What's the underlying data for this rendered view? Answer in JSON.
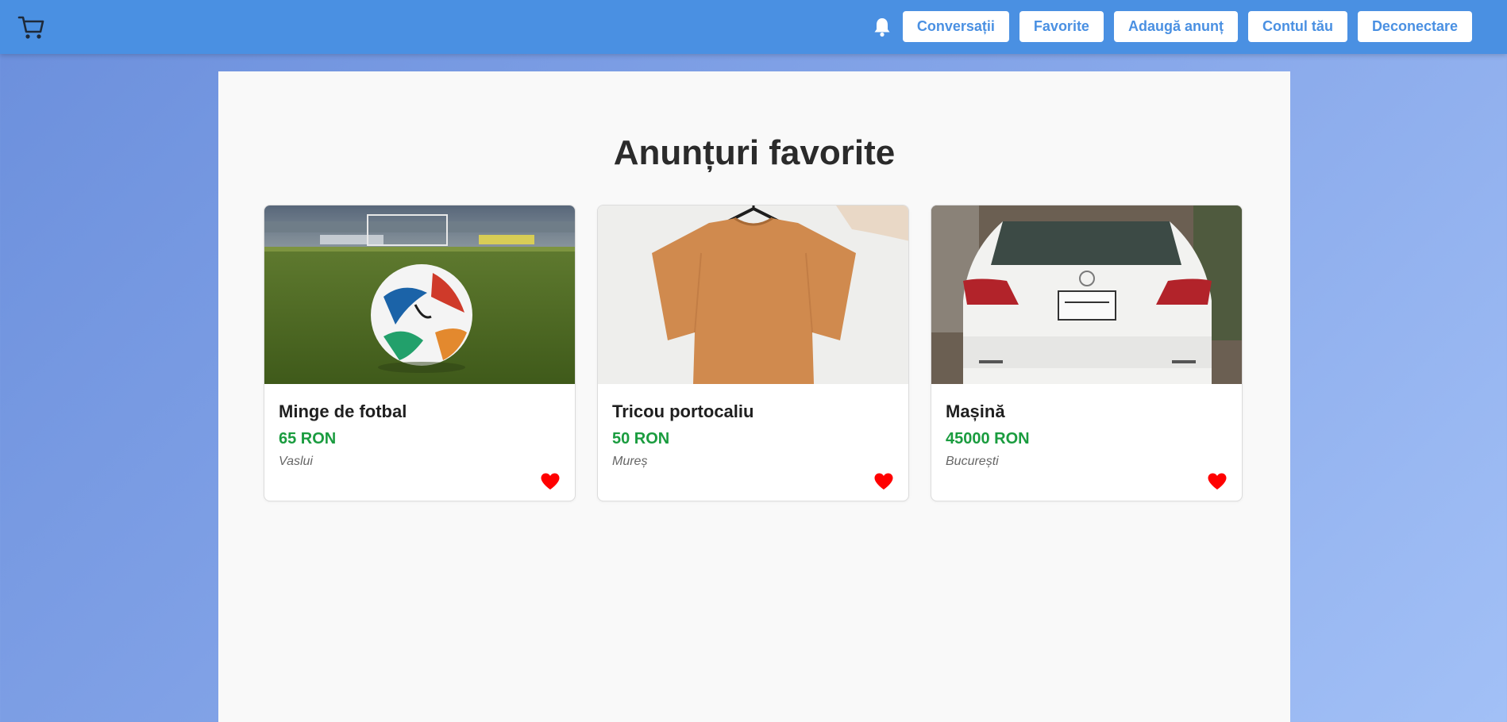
{
  "header": {
    "logo_icon": "shopping-cart-icon",
    "notification_icon": "bell-icon",
    "nav": [
      {
        "label": "Conversații"
      },
      {
        "label": "Favorite"
      },
      {
        "label": "Adaugă anunț"
      },
      {
        "label": "Contul tău"
      },
      {
        "label": "Deconectare"
      }
    ]
  },
  "main": {
    "title": "Anunțuri favorite",
    "listings": [
      {
        "title": "Minge de fotbal",
        "price": "65 RON",
        "location": "Vaslui",
        "image": "soccer-ball-on-grass",
        "favorite_icon": "heart-icon"
      },
      {
        "title": "Tricou portocaliu",
        "price": "50 RON",
        "location": "Mureș",
        "image": "orange-tshirt-on-hanger",
        "favorite_icon": "heart-icon"
      },
      {
        "title": "Mașină",
        "price": "45000 RON",
        "location": "București",
        "image": "white-car-rear",
        "favorite_icon": "heart-icon"
      }
    ]
  },
  "colors": {
    "header_bg": "#4a90e2",
    "button_text": "#4a90e2",
    "price": "#1a9c3f",
    "heart": "#ff0000"
  }
}
